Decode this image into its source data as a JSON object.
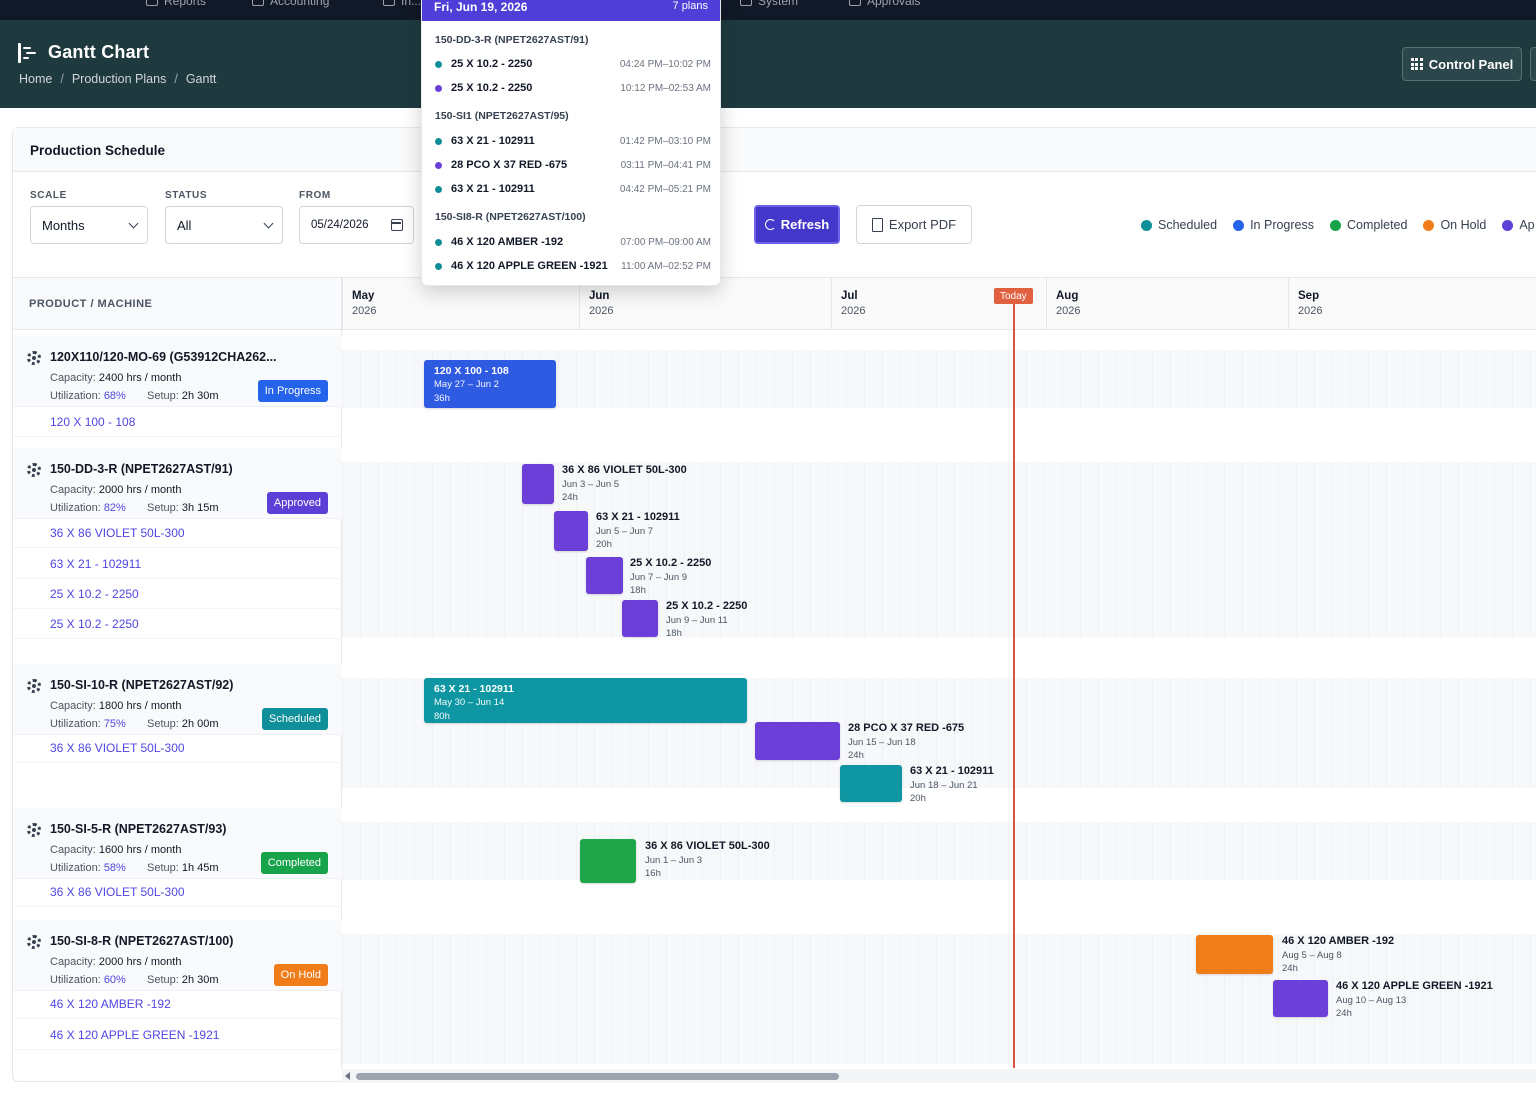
{
  "nav": {
    "items": [
      {
        "label": "Reports"
      },
      {
        "label": "Accounting"
      },
      {
        "label": "In..."
      },
      {
        "label": "System"
      },
      {
        "label": "Approvals"
      }
    ]
  },
  "header": {
    "title": "Gantt Chart",
    "breadcrumb": [
      "Home",
      "Production Plans",
      "Gantt"
    ],
    "control_panel": "Control Panel"
  },
  "card": {
    "title": "Production Schedule"
  },
  "filters": {
    "scale_label": "SCALE",
    "scale_value": "Months",
    "status_label": "STATUS",
    "status_value": "All",
    "from_label": "FROM",
    "from_value": "05/24/2026",
    "refresh": "Refresh",
    "export": "Export PDF"
  },
  "legend": [
    {
      "label": "Scheduled",
      "color": "#0e8f99"
    },
    {
      "label": "In Progress",
      "color": "#2563eb"
    },
    {
      "label": "Completed",
      "color": "#16a34a"
    },
    {
      "label": "On Hold",
      "color": "#f07d1a"
    },
    {
      "label": "Ap",
      "color": "#5b3fd6"
    }
  ],
  "gantt": {
    "column_header": "PRODUCT / MACHINE",
    "months": [
      {
        "name": "May",
        "year": "2026"
      },
      {
        "name": "Jun",
        "year": "2026"
      },
      {
        "name": "Jul",
        "year": "2026"
      },
      {
        "name": "Aug",
        "year": "2026"
      },
      {
        "name": "Sep",
        "year": "2026"
      }
    ],
    "today_label": "Today",
    "machines": [
      {
        "name": "120X110/120-MO-69 (G53912CHA262...",
        "capacity_label": "Capacity:",
        "capacity": "2400 hrs / month",
        "util_label": "Utilization:",
        "util": "68%",
        "setup_label": "Setup:",
        "setup": "2h 30m",
        "status": "In Progress",
        "status_color": "#2563eb",
        "tasks": [
          "120 X 100 - 108"
        ]
      },
      {
        "name": "150-DD-3-R (NPET2627AST/91)",
        "capacity_label": "Capacity:",
        "capacity": "2000 hrs / month",
        "util_label": "Utilization:",
        "util": "82%",
        "setup_label": "Setup:",
        "setup": "3h 15m",
        "status": "Approved",
        "status_color": "#5b3fd6",
        "tasks": [
          "36 X 86 VIOLET 50L-300",
          "63 X 21 - 102911",
          "25 X 10.2 - 2250",
          "25 X 10.2 - 2250"
        ]
      },
      {
        "name": "150-SI-10-R (NPET2627AST/92)",
        "capacity_label": "Capacity:",
        "capacity": "1800 hrs / month",
        "util_label": "Utilization:",
        "util": "75%",
        "setup_label": "Setup:",
        "setup": "2h 00m",
        "status": "Scheduled",
        "status_color": "#0e8f99",
        "tasks": [
          "36 X 86 VIOLET 50L-300"
        ]
      },
      {
        "name": "150-SI-5-R (NPET2627AST/93)",
        "capacity_label": "Capacity:",
        "capacity": "1600 hrs / month",
        "util_label": "Utilization:",
        "util": "58%",
        "setup_label": "Setup:",
        "setup": "1h 45m",
        "status": "Completed",
        "status_color": "#16a34a",
        "tasks": [
          "36 X 86 VIOLET 50L-300"
        ]
      },
      {
        "name": "150-SI-8-R (NPET2627AST/100)",
        "capacity_label": "Capacity:",
        "capacity": "2000 hrs / month",
        "util_label": "Utilization:",
        "util": "60%",
        "setup_label": "Setup:",
        "setup": "2h 30m",
        "status": "On Hold",
        "status_color": "#f07d1a",
        "tasks": [
          "46 X 120 AMBER -192",
          "46 X 120 APPLE GREEN -1921"
        ]
      }
    ],
    "bars": [
      {
        "title": "120 X 100 - 108",
        "dates": "May 27 – Jun 2",
        "hours": "36h",
        "status": "In Progress",
        "color": "#2f5be3",
        "inside": true
      },
      {
        "title": "36 X 86 VIOLET 50L-300",
        "dates": "Jun 3 – Jun 5",
        "hours": "24h",
        "status": "Approved",
        "color": "#6d3fd9",
        "inside": false
      },
      {
        "title": "63 X 21 - 102911",
        "dates": "Jun 5 – Jun 7",
        "hours": "20h",
        "status": "Approved",
        "color": "#6d3fd9",
        "inside": false
      },
      {
        "title": "25 X 10.2 - 2250",
        "dates": "Jun 7 – Jun 9",
        "hours": "18h",
        "status": "Approved",
        "color": "#6d3fd9",
        "inside": false
      },
      {
        "title": "25 X 10.2 - 2250",
        "dates": "Jun 9 – Jun 11",
        "hours": "18h",
        "status": "Approved",
        "color": "#6d3fd9",
        "inside": false
      },
      {
        "title": "63 X 21 - 102911",
        "dates": "May 30 – Jun 14",
        "hours": "80h",
        "status": "Scheduled",
        "color": "#0e97a3",
        "inside": true
      },
      {
        "title": "28 PCO X 37 RED -675",
        "dates": "Jun 15 – Jun 18",
        "hours": "24h",
        "status": "Approved",
        "color": "#6d3fd9",
        "inside": false
      },
      {
        "title": "63 X 21 - 102911",
        "dates": "Jun 18 – Jun 21",
        "hours": "20h",
        "status": "Scheduled",
        "color": "#0e97a3",
        "inside": false
      },
      {
        "title": "36 X 86 VIOLET 50L-300",
        "dates": "Jun 1 – Jun 3",
        "hours": "16h",
        "status": "Completed",
        "color": "#1fa64a",
        "inside": false
      },
      {
        "title": "46 X 120 AMBER -192",
        "dates": "Aug 5 – Aug 8",
        "hours": "24h",
        "status": "On Hold",
        "color": "#f07d1a",
        "inside": false
      },
      {
        "title": "46 X 120 APPLE GREEN -1921",
        "dates": "Aug 10 – Aug 13",
        "hours": "24h",
        "status": "Approved",
        "color": "#6d3fd9",
        "inside": false
      }
    ]
  },
  "popup": {
    "date": "Fri, Jun 19, 2026",
    "count": "7 plans",
    "groups": [
      {
        "machine": "150-DD-3-R (NPET2627AST/91)",
        "items": [
          {
            "name": "25 X 10.2 - 2250",
            "time": "04:24 PM–10:02 PM",
            "color": "#0e8f99"
          },
          {
            "name": "25 X 10.2 - 2250",
            "time": "10:12 PM–02:53 AM",
            "color": "#6d3fd9"
          }
        ]
      },
      {
        "machine": "150-SI1 (NPET2627AST/95)",
        "items": [
          {
            "name": "63 X 21 - 102911",
            "time": "01:42 PM–03:10 PM",
            "color": "#0e8f99"
          },
          {
            "name": "28 PCO X 37 RED -675",
            "time": "03:11 PM–04:41 PM",
            "color": "#6d3fd9"
          },
          {
            "name": "63 X 21 - 102911",
            "time": "04:42 PM–05:21 PM",
            "color": "#0e8f99"
          }
        ]
      },
      {
        "machine": "150-SI8-R (NPET2627AST/100)",
        "items": [
          {
            "name": "46 X 120 AMBER -192",
            "time": "07:00 PM–09:00 AM",
            "color": "#0e8f99"
          },
          {
            "name": "46 X 120 APPLE GREEN -1921",
            "time": "11:00 AM–02:52 PM",
            "color": "#0e8f99"
          }
        ]
      }
    ]
  }
}
